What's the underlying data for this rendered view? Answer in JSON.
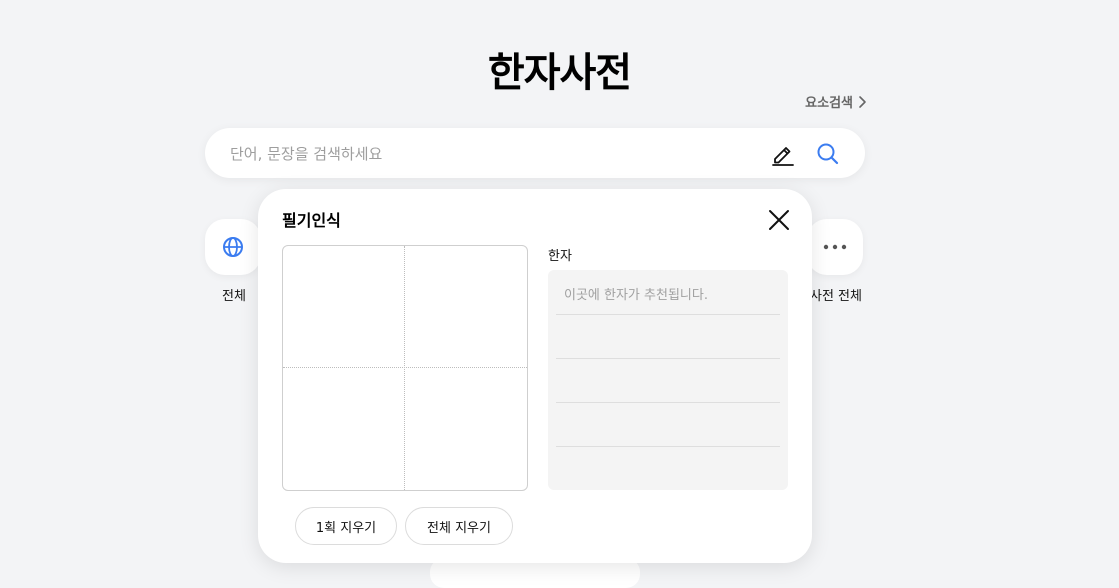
{
  "page": {
    "title": "한자사전"
  },
  "header": {
    "element_search_label": "요소검색"
  },
  "search": {
    "placeholder": "단어, 문장을 검색하세요",
    "value": "",
    "handwriting_icon": "pen-icon",
    "search_icon": "search-icon"
  },
  "categories": {
    "all": {
      "label": "전체",
      "icon": "globe-icon"
    },
    "more": {
      "label": "사전 전체",
      "icon": "more-icon"
    }
  },
  "handwriting_popup": {
    "title": "필기인식",
    "close_icon": "close-icon",
    "result_label": "한자",
    "result_hint": "이곳에 한자가 추천됩니다.",
    "undo_stroke_label": "1획 지우기",
    "clear_all_label": "전체 지우기"
  },
  "colors": {
    "accent": "#3b7cf0",
    "background": "#f3f4f6"
  }
}
